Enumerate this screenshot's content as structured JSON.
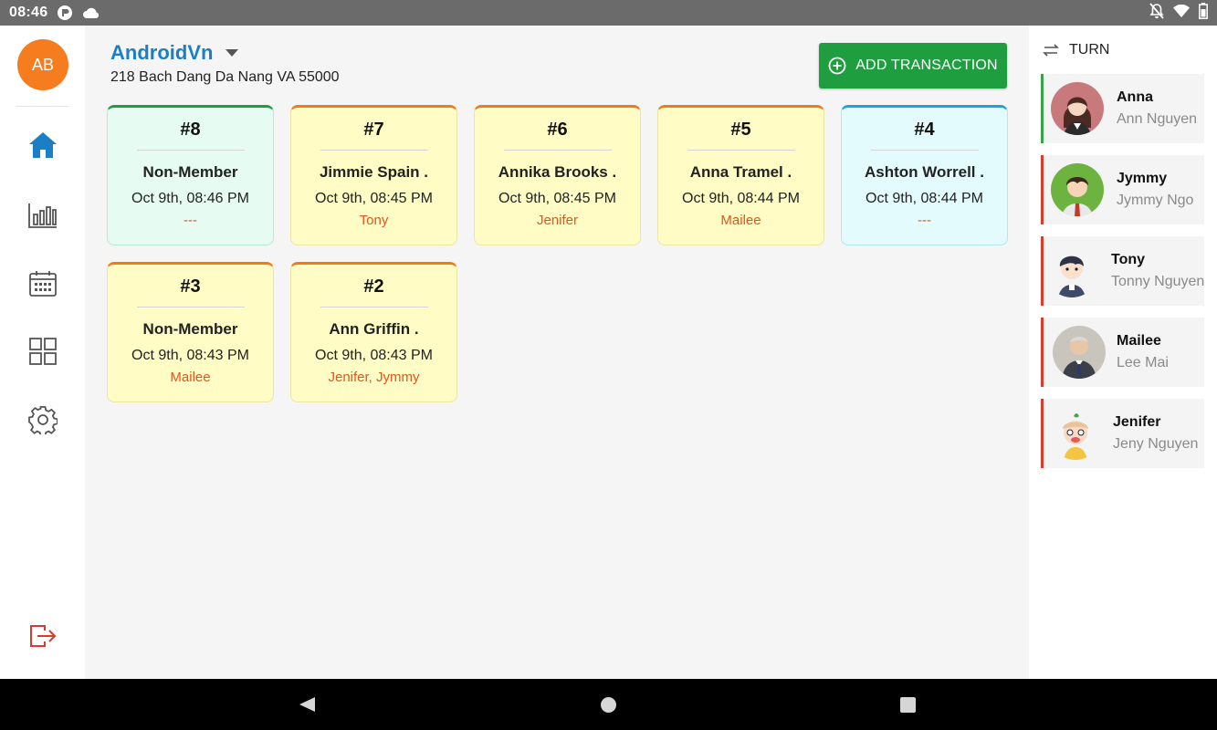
{
  "status_bar": {
    "time": "08:46",
    "left_icons": [
      "app-notification-icon",
      "cloud-icon"
    ],
    "right_icons": [
      "notifications-off-icon",
      "wifi-icon",
      "battery-icon"
    ]
  },
  "nav_rail": {
    "avatar_initials": "AB",
    "items": [
      "home-icon",
      "reports-icon",
      "calendar-icon",
      "apps-grid-icon",
      "settings-icon"
    ],
    "logout_icon": "logout-icon",
    "active_color": "#1a7fc4",
    "logout_color": "#d93a2b"
  },
  "header": {
    "store_name": "AndroidVn",
    "address": "218 Bach Dang Da Nang VA 55000",
    "add_button_label": "ADD TRANSACTION",
    "add_button_color": "#1e9e3e"
  },
  "tickets": [
    {
      "number": "#8",
      "customer": "Non-Member",
      "time": "Oct 9th, 08:46 PM",
      "staff": "---",
      "style": "mint"
    },
    {
      "number": "#7",
      "customer": "Jimmie Spain .",
      "time": "Oct 9th, 08:45 PM",
      "staff": "Tony",
      "style": "yellow"
    },
    {
      "number": "#6",
      "customer": "Annika Brooks .",
      "time": "Oct 9th, 08:45 PM",
      "staff": "Jenifer",
      "style": "yellow"
    },
    {
      "number": "#5",
      "customer": "Anna Tramel .",
      "time": "Oct 9th, 08:44 PM",
      "staff": "Mailee",
      "style": "yellow"
    },
    {
      "number": "#4",
      "customer": "Ashton Worrell .",
      "time": "Oct 9th, 08:44 PM",
      "staff": "---",
      "style": "cyan"
    },
    {
      "number": "#3",
      "customer": "Non-Member",
      "time": "Oct 9th, 08:43 PM",
      "staff": "Mailee",
      "style": "yellow"
    },
    {
      "number": "#2",
      "customer": "Ann Griffin .",
      "time": "Oct 9th, 08:43 PM",
      "staff": "Jenifer, Jymmy",
      "style": "yellow"
    }
  ],
  "turn": {
    "title": "TURN",
    "staff": [
      {
        "name": "Anna",
        "full_name": "Ann Nguyen",
        "avatar": "woman-avatar",
        "active": true
      },
      {
        "name": "Jymmy",
        "full_name": "Jymmy Ngo",
        "avatar": "man-avatar",
        "active": false
      },
      {
        "name": "Tony",
        "full_name": "Tonny Nguyen",
        "avatar": "cartoon-boy-avatar",
        "active": false
      },
      {
        "name": "Mailee",
        "full_name": "Lee Mai",
        "avatar": "photo-man-avatar",
        "active": false
      },
      {
        "name": "Jenifer",
        "full_name": "Jeny Nguyen",
        "avatar": "cartoon-girl-avatar",
        "active": false
      }
    ]
  },
  "system_nav": [
    "back-button",
    "home-button",
    "recents-button"
  ]
}
